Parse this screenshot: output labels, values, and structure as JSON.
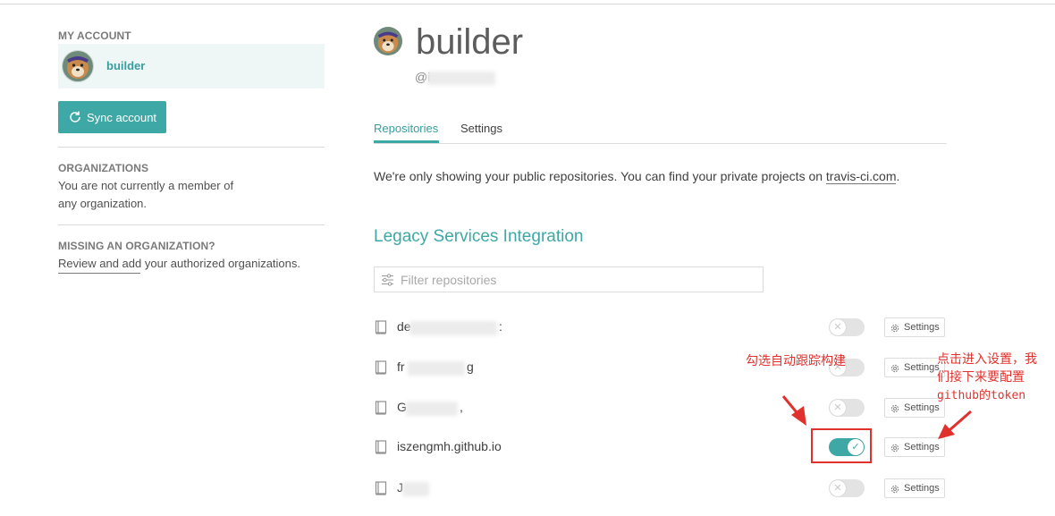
{
  "sidebar": {
    "my_account_heading": "MY ACCOUNT",
    "account_name": "builder",
    "sync_button_label": "Sync account",
    "organizations_heading": "ORGANIZATIONS",
    "organizations_text_line1": "You are not currently a member of",
    "organizations_text_line2": "any organization.",
    "missing_org_heading": "MISSING AN ORGANIZATION?",
    "missing_org_link": "Review and add",
    "missing_org_text": " your authorized organizations."
  },
  "header": {
    "title": "builder",
    "handle": "@i"
  },
  "tabs": [
    {
      "label": "Repositories",
      "active": true
    },
    {
      "label": "Settings",
      "active": false
    }
  ],
  "notice": {
    "text": "We're only showing your public repositories. You can find your private projects on ",
    "link": "travis-ci.com",
    "suffix": "."
  },
  "section_title": "Legacy Services Integration",
  "filter": {
    "placeholder": "Filter repositories"
  },
  "repos": [
    {
      "name_visible": "de",
      "name_tail": ":",
      "enabled": false,
      "settings_label": "Settings"
    },
    {
      "name_visible": "fr",
      "name_tail": "g",
      "enabled": false,
      "settings_label": "Settings"
    },
    {
      "name_visible": "G",
      "name_tail": ",",
      "enabled": false,
      "settings_label": "Settings"
    },
    {
      "name_visible": "iszengmh.github.io",
      "name_tail": "",
      "enabled": true,
      "settings_label": "Settings"
    },
    {
      "name_visible": "J",
      "name_tail": "",
      "enabled": false,
      "settings_label": "Settings"
    }
  ],
  "annotations": {
    "toggle_note": "勾选自动跟踪构建",
    "settings_note_line1": "点击进入设置，我",
    "settings_note_line2": "们接下来要配置",
    "settings_note_line3": "github的token",
    "color": "#e0312c"
  },
  "colors": {
    "accent": "#3ea8a6",
    "toggle_off": "#e3e3e3",
    "annotation_red": "#e0312c"
  }
}
